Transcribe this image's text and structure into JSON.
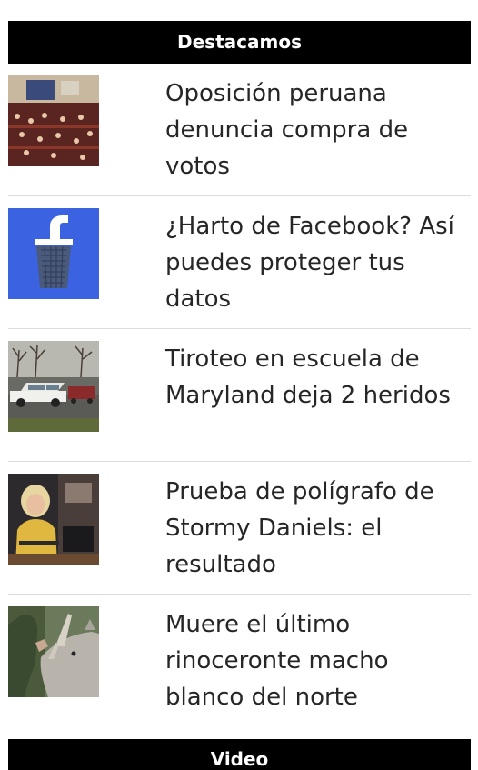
{
  "header": {
    "title": "Destacamos"
  },
  "items": [
    {
      "headline": "Oposición peruana denuncia compra de votos",
      "thumbnail": "peru-congress-photo"
    },
    {
      "headline": "¿Harto de Facebook? Así puedes proteger tus datos",
      "thumbnail": "facebook-trash-icon"
    },
    {
      "headline": "Tiroteo en escuela de Maryland deja 2 heridos",
      "thumbnail": "police-car-photo"
    },
    {
      "headline": "Prueba de polígrafo de Stormy Daniels: el resultado",
      "thumbnail": "stormy-daniels-photo"
    },
    {
      "headline": "Muere el último rinoceronte macho blanco del norte",
      "thumbnail": "rhino-photo"
    }
  ],
  "footer_section": {
    "title": "Video"
  },
  "colors": {
    "header_bg": "#000000",
    "header_text": "#ffffff",
    "facebook_blue": "#3b62e0"
  }
}
